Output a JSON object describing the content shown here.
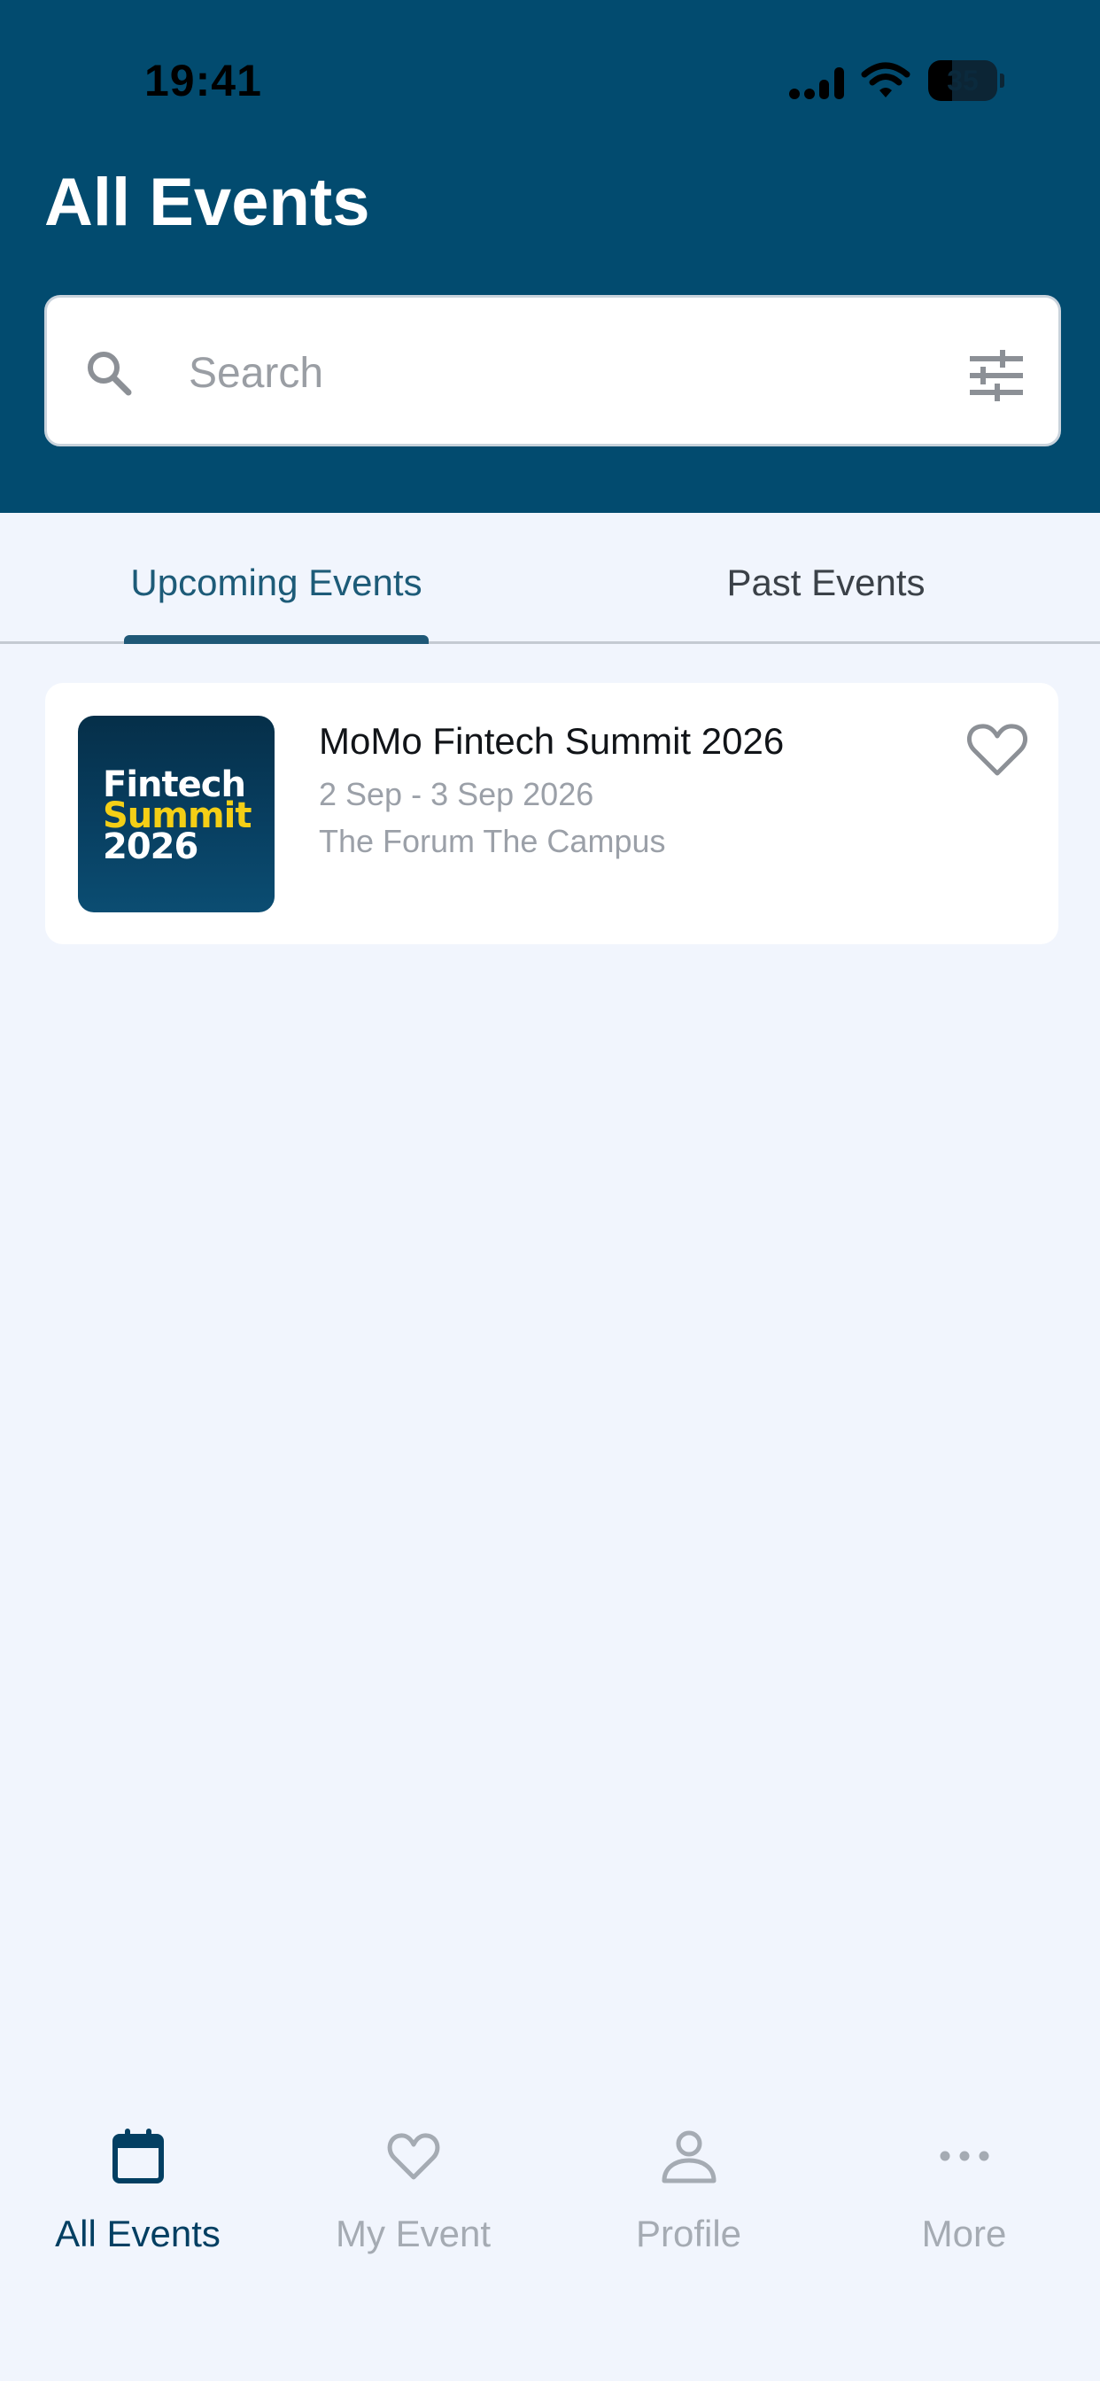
{
  "status_bar": {
    "time": "19:41",
    "battery_level": "35",
    "battery_percent": 35
  },
  "header": {
    "title": "All Events"
  },
  "search": {
    "placeholder": "Search",
    "search_icon": "search-icon",
    "filter_icon": "sliders-icon"
  },
  "tabs": [
    {
      "label": "Upcoming Events",
      "active": true
    },
    {
      "label": "Past Events",
      "active": false
    }
  ],
  "events": [
    {
      "title": "MoMo Fintech Summit 2026",
      "dates": "2 Sep - 3 Sep 2026",
      "venue": "The Forum The Campus",
      "thumbnail_text": [
        "Fintech",
        "Summit",
        "2026"
      ],
      "favorite_icon": "heart-outline-icon"
    }
  ],
  "bottom_nav": [
    {
      "label": "All Events",
      "icon": "calendar-icon",
      "active": true
    },
    {
      "label": "My Event",
      "icon": "heart-icon",
      "active": false
    },
    {
      "label": "Profile",
      "icon": "person-icon",
      "active": false
    },
    {
      "label": "More",
      "icon": "more-dots-icon",
      "active": false
    }
  ],
  "colors": {
    "header_bg": "#024b6f",
    "page_bg": "#f1f5fd",
    "accent": "#1d5b78",
    "nav_active": "#033f62",
    "nav_inactive": "#a5abb3",
    "thumb_highlight": "#f4cf16"
  }
}
